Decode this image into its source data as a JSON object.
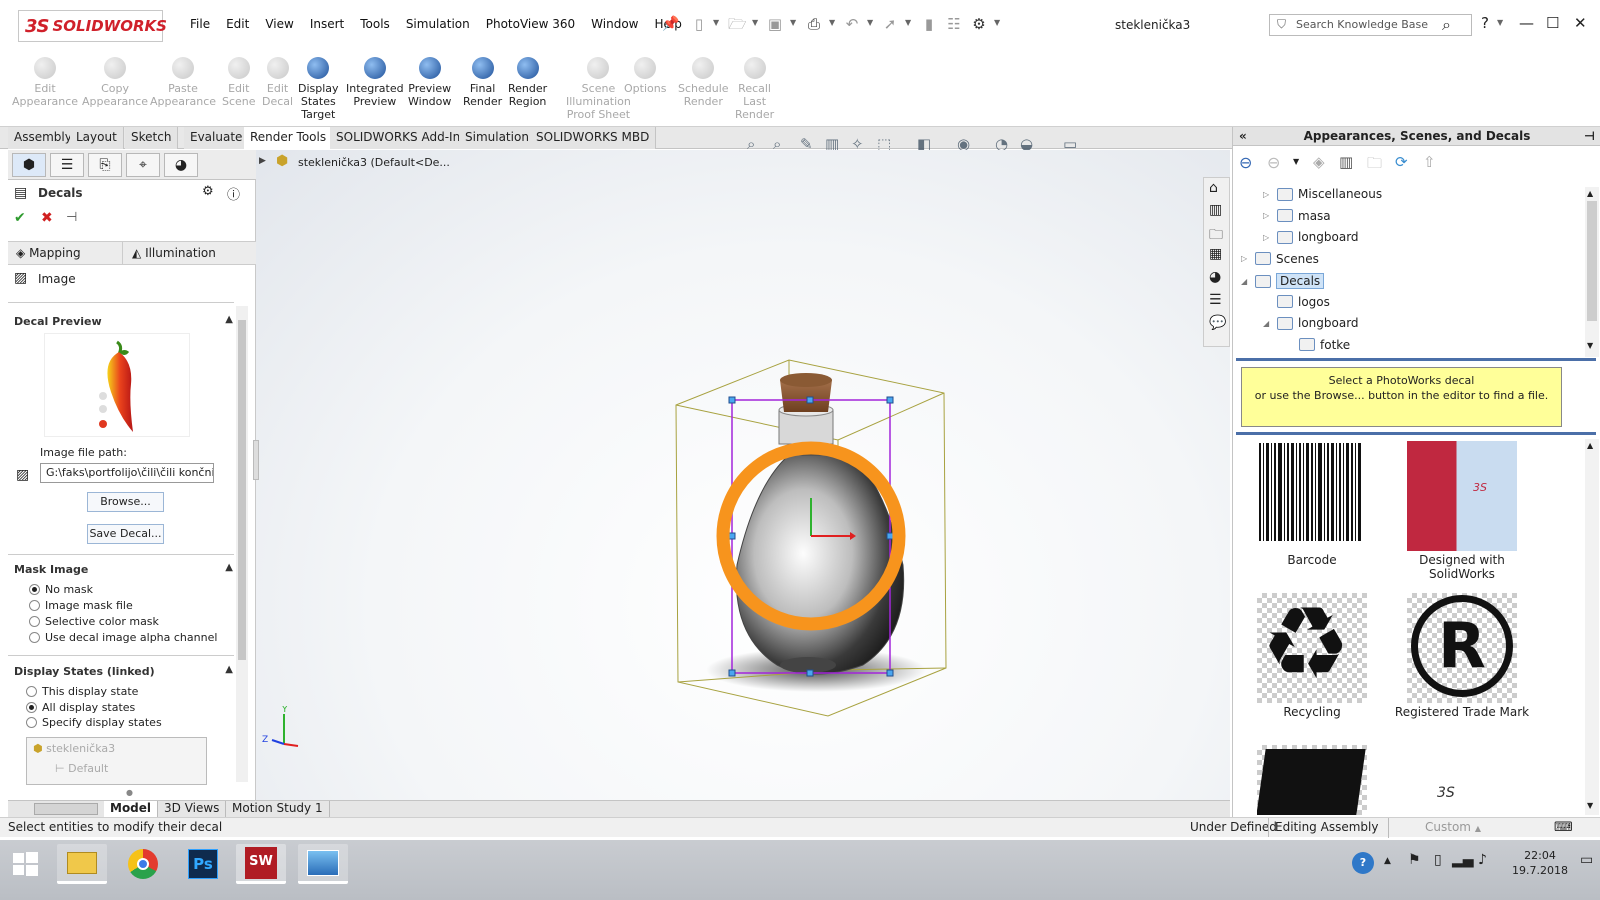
{
  "app": {
    "brand": "SOLIDWORKS",
    "brand_prefix": "3S",
    "document_title": "steklenička3"
  },
  "menu": [
    "File",
    "Edit",
    "View",
    "Insert",
    "Tools",
    "Simulation",
    "PhotoView 360",
    "Window",
    "Help"
  ],
  "search": {
    "placeholder": "Search Knowledge Base"
  },
  "ribbon": [
    {
      "label": "Edit\nAppearance",
      "enabled": false,
      "icon": "edit-appearance-icon"
    },
    {
      "label": "Copy\nAppearance",
      "enabled": false,
      "icon": "copy-appearance-icon"
    },
    {
      "label": "Paste\nAppearance",
      "enabled": false,
      "icon": "paste-appearance-icon"
    },
    {
      "label": "Edit\nScene",
      "enabled": false,
      "icon": "edit-scene-icon"
    },
    {
      "label": "Edit\nDecal",
      "enabled": false,
      "icon": "edit-decal-icon"
    },
    {
      "label": "Display\nStates\nTarget",
      "enabled": true,
      "icon": "display-states-target-icon"
    },
    {
      "label": "Integrated\nPreview",
      "enabled": true,
      "icon": "integrated-preview-icon"
    },
    {
      "label": "Preview\nWindow",
      "enabled": true,
      "icon": "preview-window-icon"
    },
    {
      "label": "Final\nRender",
      "enabled": true,
      "icon": "final-render-icon"
    },
    {
      "label": "Render\nRegion",
      "enabled": true,
      "icon": "render-region-icon"
    },
    {
      "label": "Scene\nIllumination\nProof Sheet",
      "enabled": false,
      "icon": "scene-illumination-icon"
    },
    {
      "label": "Options",
      "enabled": false,
      "icon": "options-icon"
    },
    {
      "label": "Schedule\nRender",
      "enabled": false,
      "icon": "schedule-render-icon"
    },
    {
      "label": "Recall\nLast\nRender",
      "enabled": false,
      "icon": "recall-last-render-icon"
    }
  ],
  "command_tabs": [
    "Assembly",
    "Layout",
    "Sketch",
    "Evaluate",
    "Render Tools",
    "SOLIDWORKS Add-Ins",
    "Simulation",
    "SOLIDWORKS MBD"
  ],
  "active_command_tab": "Render Tools",
  "property_manager": {
    "title": "Decals",
    "tabs": [
      "Mapping",
      "Illumination"
    ],
    "image_row": "Image",
    "decal_preview": "Decal Preview",
    "image_file_path_label": "Image file path:",
    "image_file_path": "G:\\faks\\portfolijo\\čili\\čili končni.",
    "browse": "Browse...",
    "save_decal": "Save Decal...",
    "mask_image": {
      "title": "Mask Image",
      "options": [
        "No mask",
        "Image mask file",
        "Selective color mask",
        "Use decal image alpha channel"
      ],
      "selected": "No mask"
    },
    "display_states": {
      "title": "Display States (linked)",
      "options": [
        "This display state",
        "All display states",
        "Specify display states"
      ],
      "selected": "All display states",
      "list": [
        "steklenička3",
        "Default"
      ]
    }
  },
  "feature_tree": {
    "item": "steklenička3  (Default<De..."
  },
  "view_tabs": [
    "Model",
    "3D Views",
    "Motion Study 1"
  ],
  "active_view_tab": "Model",
  "status": {
    "left": "Select entities to modify their decal",
    "state": "Under Defined",
    "mode": "Editing Assembly",
    "units": "Custom"
  },
  "task_pane": {
    "title": "Appearances, Scenes, and Decals",
    "tree": [
      {
        "label": "Miscellaneous",
        "indent": 2,
        "arrow": "▷"
      },
      {
        "label": "masa",
        "indent": 2,
        "arrow": "▷"
      },
      {
        "label": "longboard",
        "indent": 2,
        "arrow": "▷"
      },
      {
        "label": "Scenes",
        "indent": 1,
        "arrow": "▷"
      },
      {
        "label": "Decals",
        "indent": 1,
        "arrow": "◢",
        "selected": true
      },
      {
        "label": "logos",
        "indent": 2,
        "arrow": ""
      },
      {
        "label": "longboard",
        "indent": 2,
        "arrow": "◢"
      },
      {
        "label": "fotke",
        "indent": 3,
        "arrow": ""
      }
    ],
    "info": [
      "Select a PhotoWorks decal",
      "or use the Browse... button in the editor to find a file."
    ],
    "thumbnails": [
      "Barcode",
      "Designed with SolidWorks",
      "Recycling",
      "Registered Trade Mark",
      "",
      ""
    ]
  },
  "taskbar": {
    "time": "22:04",
    "date": "19.7.2018",
    "apps": [
      "file-explorer",
      "chrome",
      "photoshop",
      "solidworks-2017",
      "photos"
    ]
  },
  "colors": {
    "accent": "#d0202a",
    "decal_ring": "#f7941d",
    "info_bg": "#ffff99"
  }
}
